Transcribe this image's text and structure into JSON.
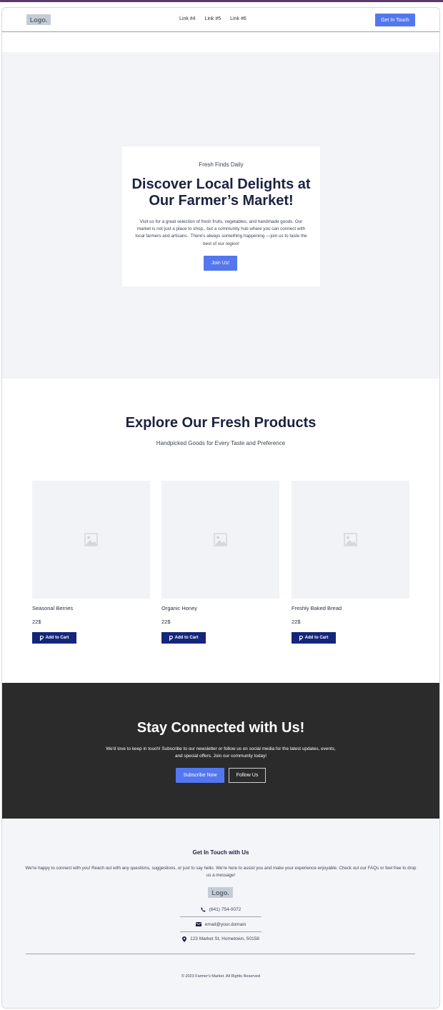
{
  "nav": {
    "logo": "Logo.",
    "links": [
      "Link #4",
      "Link #5",
      "Link #6"
    ],
    "cta": "Get In Touch"
  },
  "hero": {
    "eyebrow": "Fresh Finds Daily",
    "title": "Discover Local Delights at Our Farmer’s Market!",
    "text": "Visit us for a great selection of fresh fruits, vegetables, and handmade goods. Our market is not just a place to shop,, but a community hub where you can connect with local farmers and artisans.. There's always something happening —join us to taste the best of our region!",
    "button": "Join Us!"
  },
  "products": {
    "title": "Explore Our Fresh Products",
    "subtitle": "Handpicked Goods for Every Taste and Preference",
    "add_label": "Add to Cart",
    "items": [
      {
        "name": "Seasonal Berries",
        "price": "22$"
      },
      {
        "name": "Organic Honey",
        "price": "22$"
      },
      {
        "name": "Freshly Baked Bread",
        "price": "22$"
      }
    ]
  },
  "connect": {
    "title": "Stay Connected with Us!",
    "text": "We'd love to keep in touch! Subscribe to our newsletter or follow us on social media for the latest updates, events, and special offers. Join our community today!",
    "subscribe": "Subscribe Now",
    "follow": "Follow Us"
  },
  "footer": {
    "title": "Get In Touch with Us",
    "text": "We're happy to connect with you! Reach out with any questions, suggestions, or just to say  hello. We're here to assist you and make your experience enjoyable. Check out our FAQs or feel free to drop us a message!",
    "logo": "Logo.",
    "phone": "(641) 754-0072",
    "email": "email@your.domain",
    "address": "123 Market St, Hometown, 50158",
    "copyright": "© 2023 Farmer's Market. All Rights Reserved"
  },
  "colors": {
    "accent": "#5377ef",
    "dark_button": "#14267a",
    "dark_section": "#2b2b2b",
    "light_section": "#f3f4f7"
  }
}
